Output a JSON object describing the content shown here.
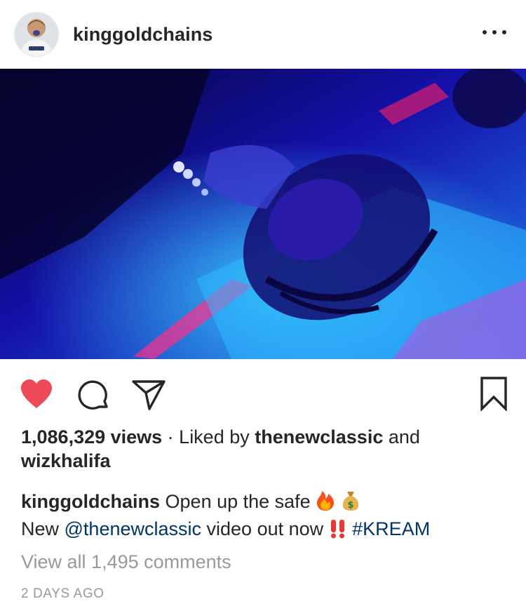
{
  "post": {
    "username": "kinggoldchains",
    "stats": {
      "views": "1,086,329 views",
      "separator": " · ",
      "liked_by_prefix": "Liked by ",
      "liked_user_1": "thenewclassic",
      "and": " and",
      "liked_user_2": "wizkhalifa"
    },
    "caption": {
      "username": "kinggoldchains",
      "text_1": " Open up the safe ",
      "line2_prefix": "New ",
      "mention": "@thenewclassic",
      "text_2": " video out now ",
      "hashtag": "#KREAM"
    },
    "view_comments": "View all 1,495 comments",
    "time_ago": "2 DAYS AGO"
  },
  "icons": {
    "more": "more-options-icon",
    "like": "heart-icon",
    "comment": "comment-icon",
    "share": "paper-plane-icon",
    "save": "bookmark-icon",
    "fire": "fire-emoji",
    "money_bag": "money-bag-emoji",
    "exclamation": "double-exclamation-emoji"
  },
  "colors": {
    "text": "#262626",
    "link": "#003569",
    "muted": "#999999",
    "like_red": "#ed4956"
  }
}
